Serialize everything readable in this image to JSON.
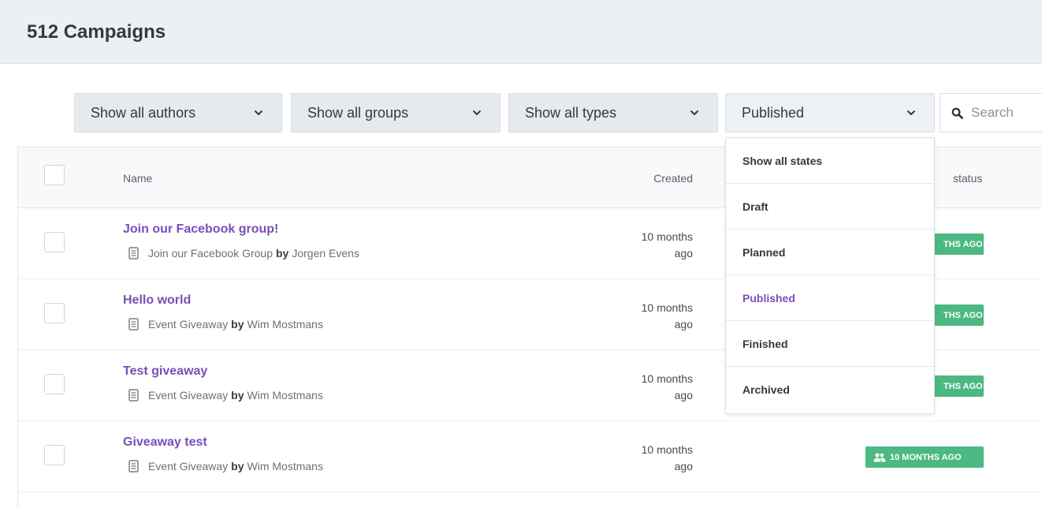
{
  "header": {
    "title": "512 Campaigns"
  },
  "filters": {
    "authors": "Show all authors",
    "groups": "Show all groups",
    "types": "Show all types",
    "state": "Published"
  },
  "search": {
    "placeholder": "Search"
  },
  "table": {
    "columns": {
      "name": "Name",
      "created": "Created",
      "status": "status"
    },
    "rows": [
      {
        "title": "Join our Facebook group!",
        "type": "Join our Facebook Group",
        "by": "by",
        "author": "Jorgen Evens",
        "created_line1": "10 months",
        "created_line2": "ago",
        "status": "THS AGO"
      },
      {
        "title": "Hello world",
        "type": "Event Giveaway",
        "by": "by",
        "author": "Wim Mostmans",
        "created_line1": "10 months",
        "created_line2": "ago",
        "status": "THS AGO"
      },
      {
        "title": "Test giveaway",
        "type": "Event Giveaway",
        "by": "by",
        "author": "Wim Mostmans",
        "created_line1": "10 months",
        "created_line2": "ago",
        "status": "THS AGO"
      },
      {
        "title": "Giveaway test",
        "type": "Event Giveaway",
        "by": "by",
        "author": "Wim Mostmans",
        "created_line1": "10 months",
        "created_line2": "ago",
        "status": "10 MONTHS AGO"
      }
    ]
  },
  "state_dropdown": {
    "options": [
      "Show all states",
      "Draft",
      "Planned",
      "Published",
      "Finished",
      "Archived"
    ],
    "selected": "Published"
  },
  "colors": {
    "accent": "#7a4eb5",
    "status_green": "#4cb882",
    "header_bg": "#ecf0f5"
  },
  "icons": {
    "filter_arrow": "chevron-down-icon",
    "search": "search-icon",
    "row_type": "document-icon",
    "status": "people-icon"
  }
}
